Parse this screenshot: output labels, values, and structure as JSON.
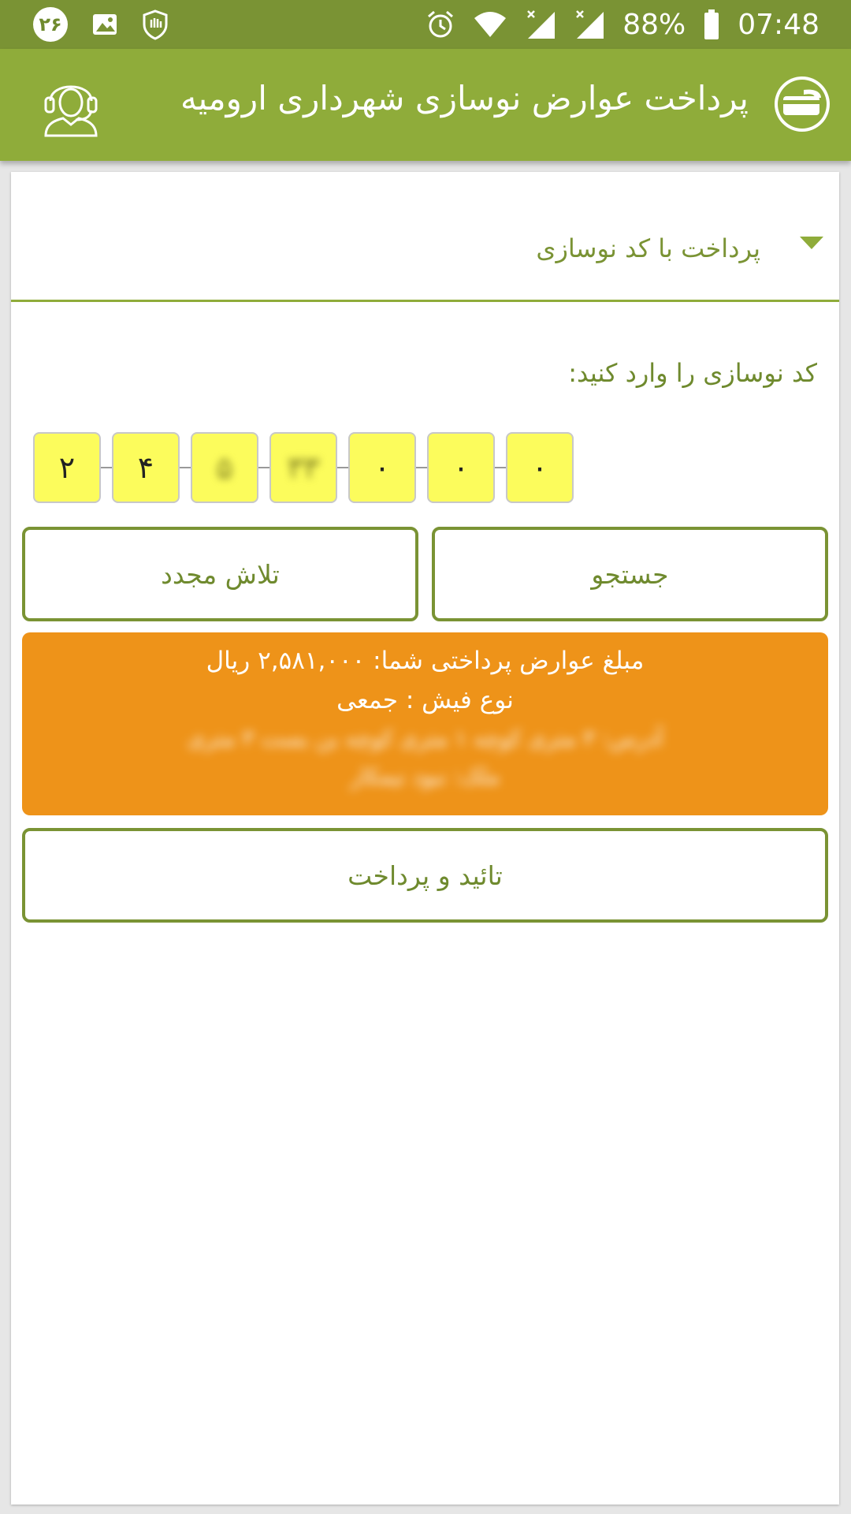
{
  "status_bar": {
    "notification_badge": "۲۶",
    "battery_percent": "88%",
    "time": "07:48"
  },
  "app_bar": {
    "title": "پرداخت عوارض نوسازی شهرداری ارومیه"
  },
  "payment_method": {
    "selected": "پرداخت با کد نوسازی"
  },
  "code_entry": {
    "prompt": "کد نوسازی را وارد کنید:",
    "digits": [
      "۲",
      "۴",
      "۵",
      "۳۳",
      "۰",
      "۰",
      "۰"
    ]
  },
  "buttons": {
    "search": "جستجو",
    "retry": "تلاش مجدد",
    "confirm_pay": "تائید و پرداخت"
  },
  "result": {
    "amount_line": "مبلغ عوارض پرداختی شما: ۲,۵۸۱,۰۰۰ ریال",
    "receipt_type_line": "نوع فیش : جمعی",
    "address_line_1": "آدرس: ۳ متری کوچه ۱ متری کوچه بن بست ۳ متری",
    "address_line_2": "ملک: نبود نیمکار"
  },
  "colors": {
    "status_bar": "#7a9334",
    "app_bar": "#8fac3a",
    "accent_green": "#7a9334",
    "code_box_fill": "#fcfc5c",
    "result_orange": "#ee9319"
  },
  "icons": {
    "app_logo": "payment-card-logo-icon",
    "support": "headset-support-icon",
    "dropdown": "triangle-down-icon"
  }
}
